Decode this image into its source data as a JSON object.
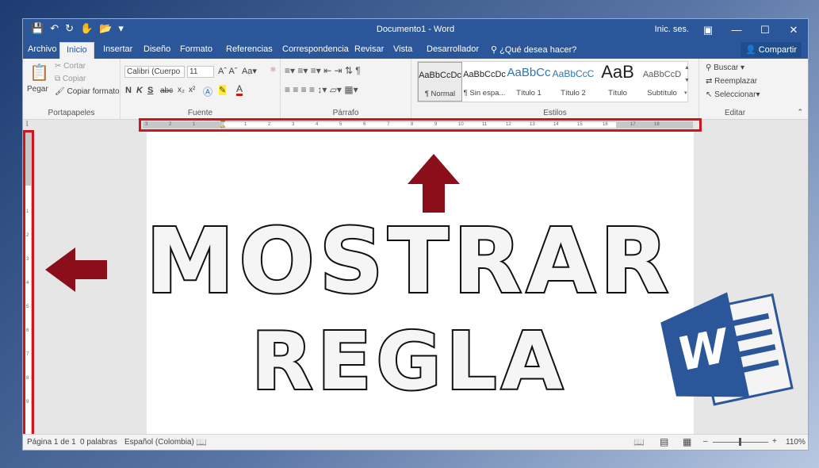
{
  "window": {
    "title": "Documento1 - Word",
    "signin": "Inic. ses."
  },
  "tabs": [
    "Archivo",
    "Inicio",
    "Insertar",
    "Diseño",
    "Formato",
    "Referencias",
    "Correspondencia",
    "Revisar",
    "Vista",
    "Desarrollador"
  ],
  "tellme": "¿Qué desea hacer?",
  "share": "Compartir",
  "clipboard": {
    "paste": "Pegar",
    "cut": "Cortar",
    "copy": "Copiar",
    "format": "Copiar formato",
    "label": "Portapapeles"
  },
  "font": {
    "name": "Calibri (Cuerpo",
    "size": "11",
    "label": "Fuente"
  },
  "paragraph": {
    "label": "Párrafo"
  },
  "styles": {
    "label": "Estilos",
    "items": [
      {
        "sample": "AaBbCcDc",
        "name": "¶ Normal"
      },
      {
        "sample": "AaBbCcDc",
        "name": "¶ Sin espa..."
      },
      {
        "sample": "AaBbCc",
        "name": "Título 1"
      },
      {
        "sample": "AaBbCcC",
        "name": "Título 2"
      },
      {
        "sample": "AaB",
        "name": "Título"
      },
      {
        "sample": "AaBbCcD",
        "name": "Subtítulo"
      }
    ]
  },
  "edit": {
    "find": "Buscar",
    "replace": "Reemplazar",
    "select": "Seleccionar",
    "label": "Editar"
  },
  "ruler": {
    "h_ticks": [
      "3",
      "2",
      "1",
      "1",
      "2",
      "3",
      "4",
      "5",
      "6",
      "7",
      "8",
      "9",
      "10",
      "11",
      "12",
      "13",
      "14",
      "15",
      "16",
      "17",
      "18"
    ],
    "v_ticks": [
      "1",
      "2",
      "3",
      "4",
      "5",
      "6",
      "7",
      "8",
      "9"
    ]
  },
  "overlay": {
    "line1": "MOSTRAR",
    "line2": "REGLA"
  },
  "status": {
    "page": "Página 1 de 1",
    "words": "0 palabras",
    "lang": "Español (Colombia)",
    "zoom": "110%"
  },
  "colors": {
    "accent": "#2b579a",
    "highlight": "#d0161c",
    "arrow": "#8b0f1a"
  }
}
